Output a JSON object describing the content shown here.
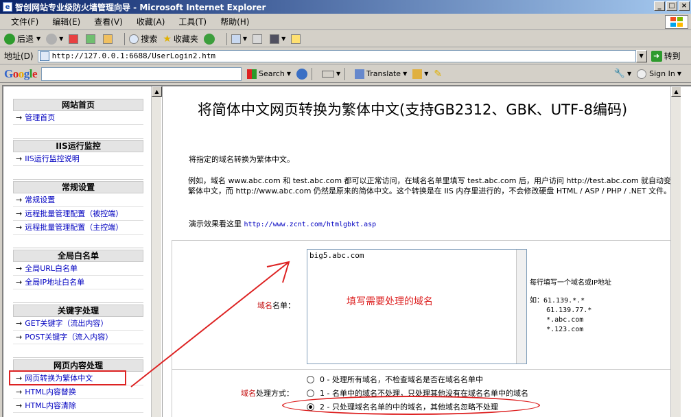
{
  "window": {
    "title": "智创网站专业级防火墙管理向导 - Microsoft Internet Explorer"
  },
  "menu": [
    "文件(F)",
    "编辑(E)",
    "查看(V)",
    "收藏(A)",
    "工具(T)",
    "帮助(H)"
  ],
  "toolbar": {
    "back": "后退",
    "search": "搜索",
    "favorites": "收藏夹"
  },
  "address": {
    "label": "地址(D)",
    "url": "http://127.0.0.1:6688/UserLogin2.htm",
    "go": "转到"
  },
  "google": {
    "logo": "Google",
    "search": "Search",
    "translate": "Translate",
    "signin": "Sign In"
  },
  "sidebar": [
    {
      "title": "网站首页",
      "items": [
        "管理首页"
      ]
    },
    {
      "title": "IIS运行监控",
      "items": [
        "IIS运行监控说明"
      ]
    },
    {
      "title": "常规设置",
      "items": [
        "常规设置",
        "远程批量管理配置（被控端）",
        "远程批量管理配置（主控端）"
      ]
    },
    {
      "title": "全局白名单",
      "items": [
        "全局URL白名单",
        "全局IP地址白名单"
      ]
    },
    {
      "title": "关键字处理",
      "items": [
        "GET关键字（流出内容）",
        "POST关键字（流入内容）"
      ]
    },
    {
      "title": "网页内容处理",
      "items": [
        "网页转换为繁体中文",
        "HTML内容替换",
        "HTML内容清除"
      ]
    }
  ],
  "main": {
    "title": "将简体中文网页转换为繁体中文(支持GB2312、GBK、UTF-8编码)",
    "intro": "将指定的域名转换为繁体中文。",
    "desc": "例如，域名 www.abc.com 和 test.abc.com 都可以正常访问，在域名名单里填写 test.abc.com 后，用户访问 http://test.abc.com 就自动变成繁体中文，而 http://www.abc.com 仍然是原来的简体中文。这个转换是在 IIS 内存里进行的，不会修改硬盘 HTML / ASP / PHP / .NET 文件。",
    "demo_label": "演示效果看这里",
    "demo_link": "http://www.zcnt.com/htmlgbkt.asp",
    "domain_label_red": "域名",
    "domain_label_rest": "名单：",
    "domain_value": "big5.abc.com",
    "hint": "每行填写一个域名或IP地址",
    "example": "如：61.139.*.*\n    61.139.77.*\n    *.abc.com\n    *.123.com",
    "annotation": "填写需要处理的域名",
    "mode_label_red": "域名",
    "mode_label_rest": "处理方式：",
    "options": [
      {
        "text": "0 - 处理所有域名，不检查域名是否在域名名单中",
        "checked": false
      },
      {
        "text": "1 - 名单中的域名不处理，只处理其他没有在域名名单中的域名",
        "checked": false
      },
      {
        "text": "2 - 只处理域名名单的中的域名，其他域名忽略不处理",
        "checked": true
      }
    ]
  }
}
